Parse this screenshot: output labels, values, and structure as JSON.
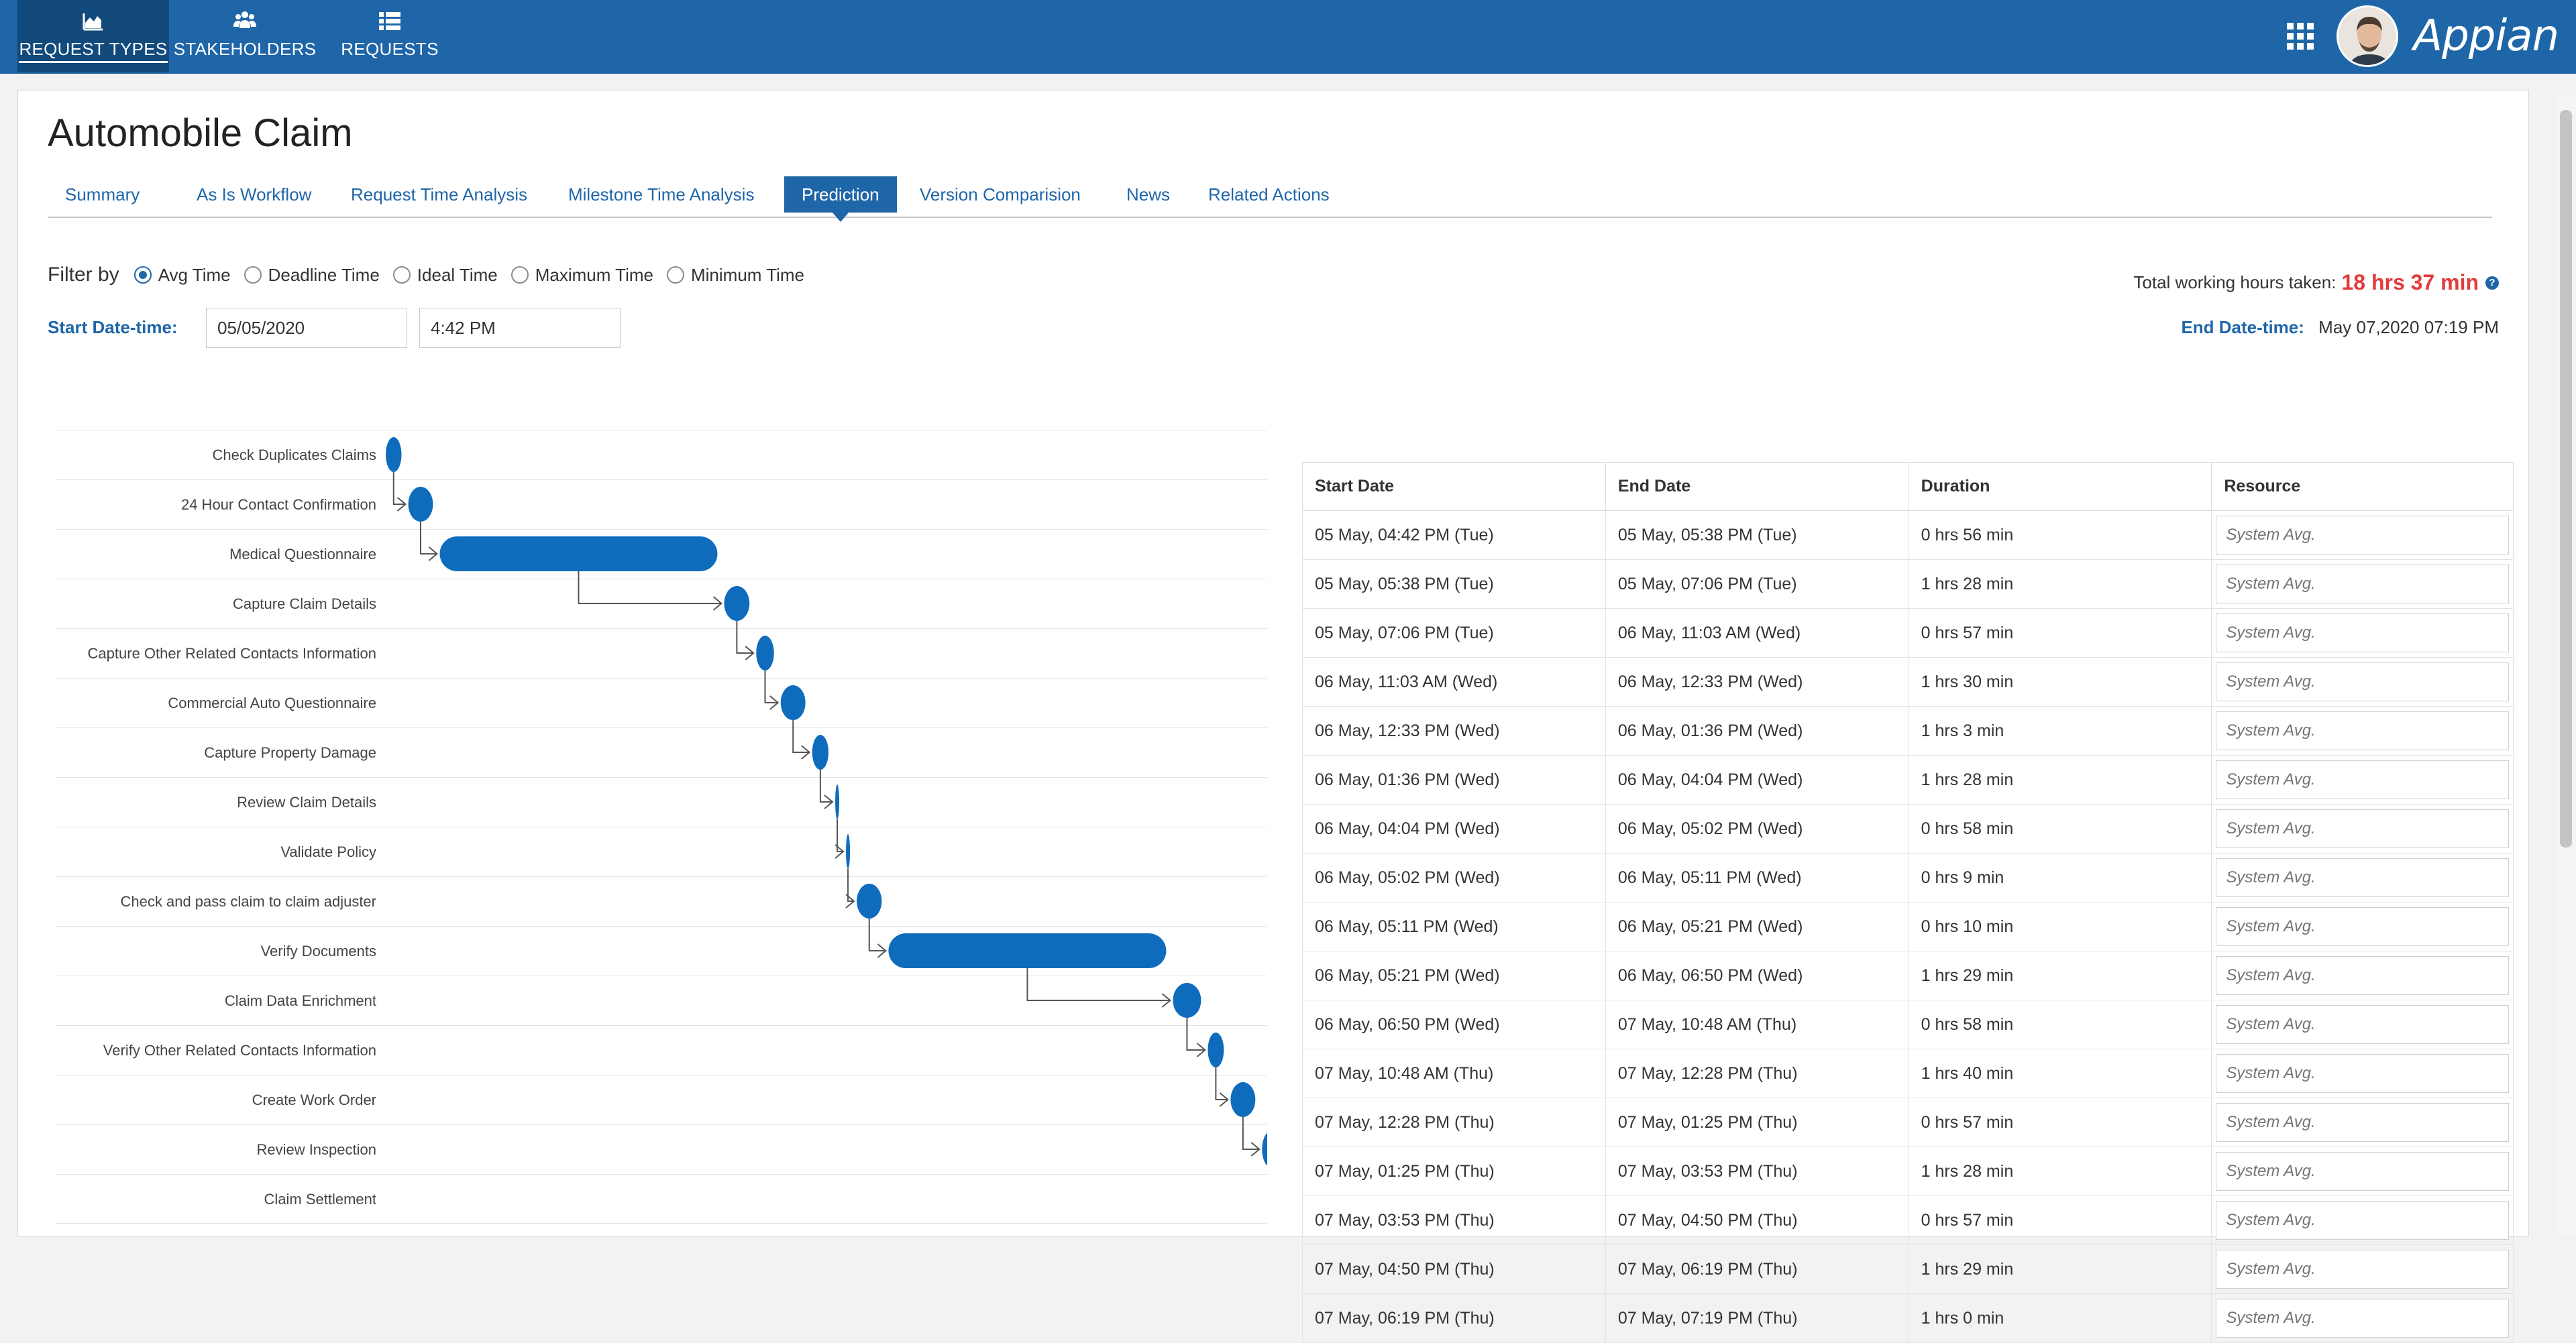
{
  "nav": {
    "items": [
      {
        "label": "REQUEST TYPES",
        "icon": "chart-area-icon"
      },
      {
        "label": "STAKEHOLDERS",
        "icon": "users-icon"
      },
      {
        "label": "REQUESTS",
        "icon": "list-icon"
      }
    ],
    "brand": "Appian"
  },
  "page": {
    "title": "Automobile Claim",
    "tabs": [
      "Summary",
      "As Is Workflow",
      "Request Time Analysis",
      "Milestone Time Analysis",
      "Prediction",
      "Version Comparision",
      "News",
      "Related Actions"
    ],
    "active_tab": "Prediction"
  },
  "filter": {
    "label": "Filter by",
    "options": [
      "Avg Time",
      "Deadline Time",
      "Ideal Time",
      "Maximum Time",
      "Minimum Time"
    ],
    "selected": "Avg Time"
  },
  "start": {
    "label": "Start Date-time:",
    "date": "05/05/2020",
    "time": "4:42 PM"
  },
  "end": {
    "label": "End Date-time:",
    "value": "May 07,2020 07:19 PM"
  },
  "total": {
    "label": "Total working hours taken:",
    "value": "18 hrs 37 min"
  },
  "gantt": {
    "tasks": [
      "Check Duplicates Claims",
      "24 Hour Contact Confirmation",
      "Medical Questionnaire",
      "Capture Claim Details",
      "Capture Other Related Contacts Information",
      "Commercial Auto Questionnaire",
      "Capture Property Damage",
      "Review Claim Details",
      "Validate Policy",
      "Check and pass claim to claim adjuster",
      "Verify Documents",
      "Claim Data Enrichment",
      "Verify Other Related Contacts Information",
      "Create Work Order",
      "Review Inspection",
      "Claim Settlement"
    ],
    "bar_color": "#0f6cbd"
  },
  "table": {
    "headers": [
      "Start Date",
      "End Date",
      "Duration",
      "Resource"
    ],
    "resource_placeholder": "System Avg.",
    "rows": [
      [
        "05 May, 04:42 PM (Tue)",
        "05 May, 05:38 PM (Tue)",
        "0 hrs 56 min"
      ],
      [
        "05 May, 05:38 PM (Tue)",
        "05 May, 07:06 PM (Tue)",
        "1 hrs 28 min"
      ],
      [
        "05 May, 07:06 PM (Tue)",
        "06 May, 11:03 AM (Wed)",
        "0 hrs 57 min"
      ],
      [
        "06 May, 11:03 AM (Wed)",
        "06 May, 12:33 PM (Wed)",
        "1 hrs 30 min"
      ],
      [
        "06 May, 12:33 PM (Wed)",
        "06 May, 01:36 PM (Wed)",
        "1 hrs 3 min"
      ],
      [
        "06 May, 01:36 PM (Wed)",
        "06 May, 04:04 PM (Wed)",
        "1 hrs 28 min"
      ],
      [
        "06 May, 04:04 PM (Wed)",
        "06 May, 05:02 PM (Wed)",
        "0 hrs 58 min"
      ],
      [
        "06 May, 05:02 PM (Wed)",
        "06 May, 05:11 PM (Wed)",
        "0 hrs 9 min"
      ],
      [
        "06 May, 05:11 PM (Wed)",
        "06 May, 05:21 PM (Wed)",
        "0 hrs 10 min"
      ],
      [
        "06 May, 05:21 PM (Wed)",
        "06 May, 06:50 PM (Wed)",
        "1 hrs 29 min"
      ],
      [
        "06 May, 06:50 PM (Wed)",
        "07 May, 10:48 AM (Thu)",
        "0 hrs 58 min"
      ],
      [
        "07 May, 10:48 AM (Thu)",
        "07 May, 12:28 PM (Thu)",
        "1 hrs 40 min"
      ],
      [
        "07 May, 12:28 PM (Thu)",
        "07 May, 01:25 PM (Thu)",
        "0 hrs 57 min"
      ],
      [
        "07 May, 01:25 PM (Thu)",
        "07 May, 03:53 PM (Thu)",
        "1 hrs 28 min"
      ],
      [
        "07 May, 03:53 PM (Thu)",
        "07 May, 04:50 PM (Thu)",
        "0 hrs 57 min"
      ],
      [
        "07 May, 04:50 PM (Thu)",
        "07 May, 06:19 PM (Thu)",
        "1 hrs 29 min"
      ],
      [
        "07 May, 06:19 PM (Thu)",
        "07 May, 07:19 PM (Thu)",
        "1 hrs 0 min"
      ]
    ]
  }
}
